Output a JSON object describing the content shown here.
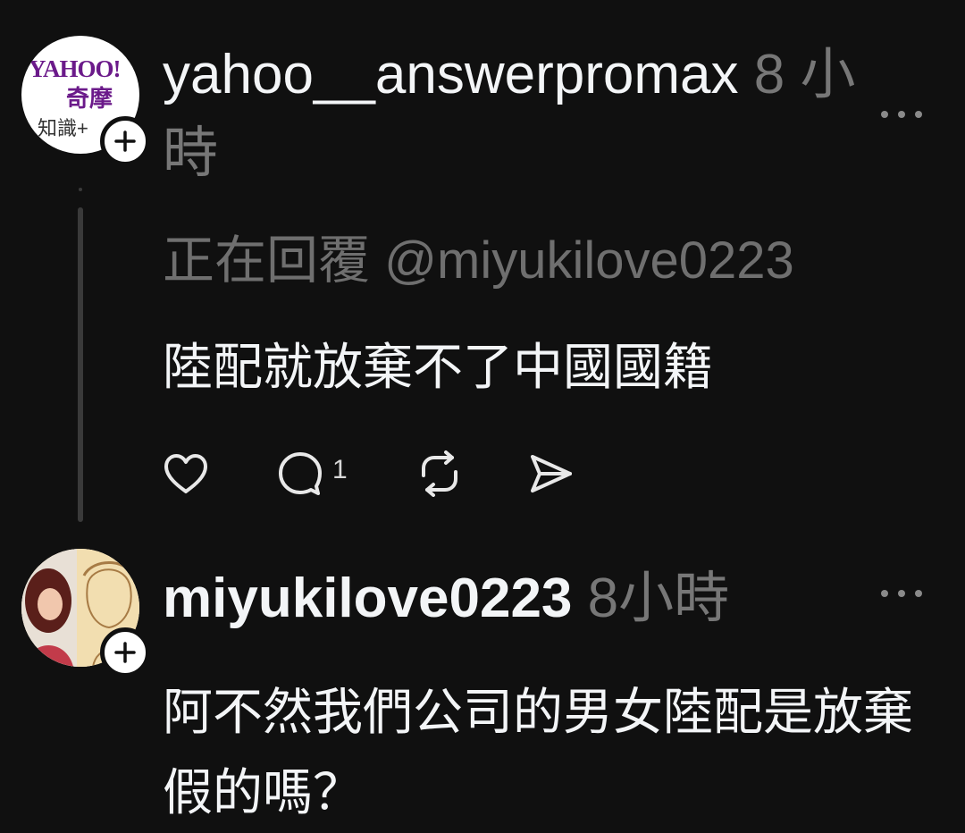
{
  "posts": [
    {
      "username": "yahoo__answerpromax",
      "time": "8 小時",
      "avatar": {
        "logo_text": "YAHOO!",
        "logo_sub": "奇摩",
        "logo_small": "知識+"
      },
      "replying_to_prefix": "正在回覆",
      "replying_to_handle": "@miyukilove0223",
      "body": "陸配就放棄不了中國國籍",
      "actions": {
        "like_icon": "heart-icon",
        "reply_icon": "comment-icon",
        "reply_count": "1",
        "repost_icon": "repost-icon",
        "share_icon": "send-icon"
      }
    },
    {
      "username": "miyukilove0223",
      "time": "8小時",
      "body": "阿不然我們公司的男女陸配是放棄假的嗎？"
    }
  ],
  "icons": {
    "follow": "plus-icon",
    "more": "more-options-icon"
  },
  "colors": {
    "background": "#101010",
    "primary_text": "#f3f5f7",
    "secondary_text": "#777777",
    "thread_line": "#3a3a3a"
  }
}
